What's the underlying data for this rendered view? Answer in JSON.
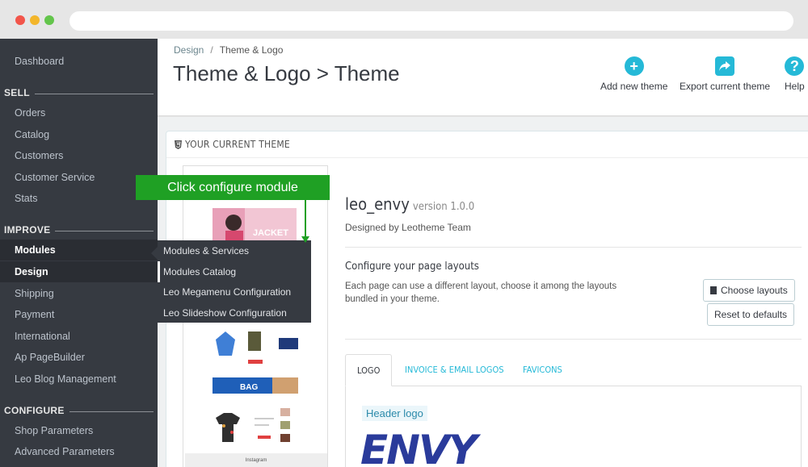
{
  "sidebar": {
    "dashboard": "Dashboard",
    "sell_header": "SELL",
    "sell_items": [
      "Orders",
      "Catalog",
      "Customers",
      "Customer Service",
      "Stats"
    ],
    "improve_header": "IMPROVE",
    "improve_items": [
      "Modules",
      "Design",
      "Shipping",
      "Payment",
      "International",
      "Ap PageBuilder",
      "Leo Blog Management"
    ],
    "configure_header": "CONFIGURE",
    "configure_items": [
      "Shop Parameters",
      "Advanced Parameters"
    ]
  },
  "submenu": {
    "items": [
      "Modules & Services",
      "Modules Catalog",
      "Leo Megamenu Configuration",
      "Leo Slideshow Configuration"
    ]
  },
  "header": {
    "breadcrumb_parent": "Design",
    "breadcrumb_current": "Theme & Logo",
    "title": "Theme & Logo > Theme",
    "tools": [
      "Add new theme",
      "Export current theme",
      "Help"
    ]
  },
  "panel": {
    "heading": "YOUR CURRENT THEME",
    "theme_name": "leo_envy",
    "theme_version": "version 1.0.0",
    "designed_by": "Designed by Leotheme Team",
    "configure_title": "Configure your page layouts",
    "configure_desc": "Each page can use a different layout, choose it among the layouts bundled in your theme.",
    "choose_layouts": "Choose layouts",
    "reset_defaults": "Reset to defaults",
    "tabs": [
      "LOGO",
      "INVOICE & EMAIL LOGOS",
      "FAVICONS"
    ],
    "header_logo_label": "Header logo",
    "logo_text": "ENVY"
  },
  "preview": {
    "banner_text": "JACKET",
    "bag_text": "BAG",
    "instagram": "Instagram"
  },
  "annotation": {
    "text": "Click configure module"
  },
  "colors": {
    "sidebar_bg": "#363a41",
    "accent": "#25b9d7",
    "callout": "#1fa024"
  }
}
